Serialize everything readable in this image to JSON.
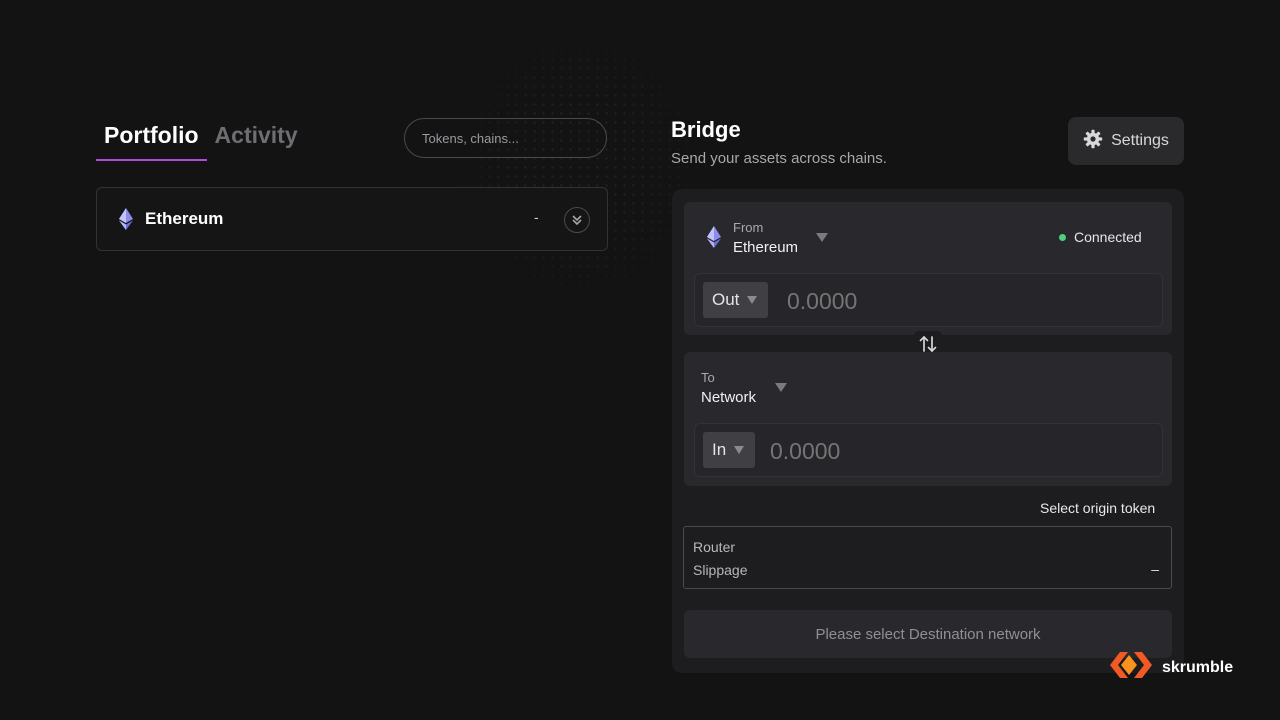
{
  "left": {
    "tabs": [
      {
        "label": "Portfolio",
        "active": true
      },
      {
        "label": "Activity",
        "active": false
      }
    ],
    "search": {
      "placeholder": "Tokens, chains..."
    },
    "chains": [
      {
        "name": "Ethereum",
        "value": "-",
        "icon": "ethereum-icon"
      }
    ]
  },
  "bridge": {
    "title": "Bridge",
    "subtitle": "Send your assets across chains.",
    "settings_label": "Settings",
    "from": {
      "label": "From",
      "network": "Ethereum",
      "status": "Connected",
      "token_label": "Out",
      "amount_placeholder": "0.0000"
    },
    "to": {
      "label": "To",
      "network": "Network",
      "token_label": "In",
      "amount_placeholder": "0.0000"
    },
    "select_origin": "Select origin token",
    "info": {
      "router_label": "Router",
      "slippage_label": "Slippage",
      "slippage_value": "–"
    },
    "action_label": "Please select Destination network"
  },
  "brand": {
    "name": "skrumble"
  },
  "colors": {
    "background": "#131313",
    "accent": "#b64ad6",
    "connected": "#4ed07a",
    "brand": "#f15a24"
  }
}
